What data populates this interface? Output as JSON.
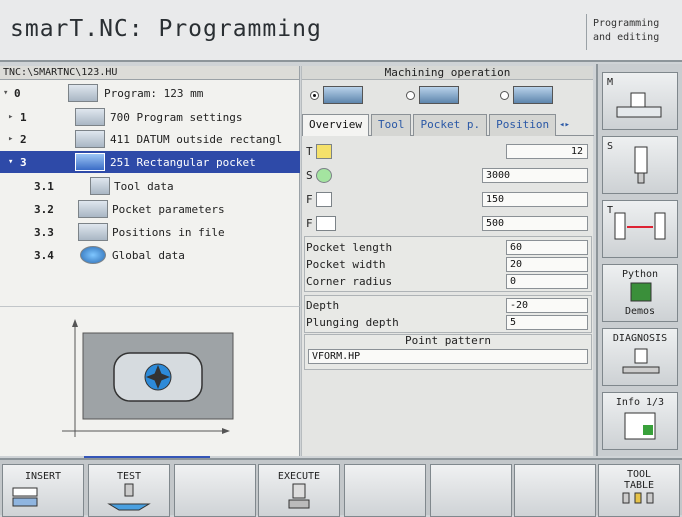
{
  "header": {
    "title": "smarT.NC: Programming",
    "mode_line1": "Programming",
    "mode_line2": "and editing"
  },
  "tree": {
    "path": "TNC:\\SMARTNC\\123.HU",
    "items": [
      {
        "num": "0",
        "label": "Program: 123 mm",
        "icon": "program-icon"
      },
      {
        "num": "1",
        "label": "700 Program settings",
        "icon": "settings-icon"
      },
      {
        "num": "2",
        "label": "411 DATUM outside rectangl",
        "icon": "datum-icon"
      },
      {
        "num": "3",
        "label": "251 Rectangular pocket",
        "icon": "pocket-icon"
      },
      {
        "num": "3.1",
        "label": "Tool data",
        "icon": "tool-icon"
      },
      {
        "num": "3.2",
        "label": "Pocket parameters",
        "icon": "pocket-params-icon"
      },
      {
        "num": "3.3",
        "label": "Positions in file",
        "icon": "positions-icon"
      },
      {
        "num": "3.4",
        "label": "Global data",
        "icon": "globe-icon"
      }
    ]
  },
  "form": {
    "title": "Machining operation",
    "tabs": [
      "Overview",
      "Tool",
      "Pocket p.",
      "Position"
    ],
    "tool_value": "12",
    "spindle_value": "3000",
    "feed_plunge_value": "150",
    "feed_value": "500",
    "pocket_length_label": "Pocket length",
    "pocket_length": "60",
    "pocket_width_label": "Pocket width",
    "pocket_width": "20",
    "corner_radius_label": "Corner radius",
    "corner_radius": "0",
    "depth_label": "Depth",
    "depth": "-20",
    "plunging_depth_label": "Plunging depth",
    "plunging_depth": "5",
    "point_pattern_label": "Point pattern",
    "point_pattern_value": "VFORM.HP",
    "field_letters": {
      "t": "T",
      "s": "S",
      "f1": "F",
      "f2": "F"
    }
  },
  "right_keys": {
    "m": "M",
    "s": "S",
    "t": "T",
    "python_1": "Python",
    "python_2": "Demos",
    "diagnosis": "DIAGNOSIS",
    "info": "Info 1/3"
  },
  "bottom_keys": {
    "insert": "INSERT",
    "test": "TEST",
    "execute": "EXECUTE",
    "tool_table_1": "TOOL",
    "tool_table_2": "TABLE"
  },
  "colors": {
    "selection": "#2e4aa8",
    "tab_text": "#2a58a6"
  }
}
